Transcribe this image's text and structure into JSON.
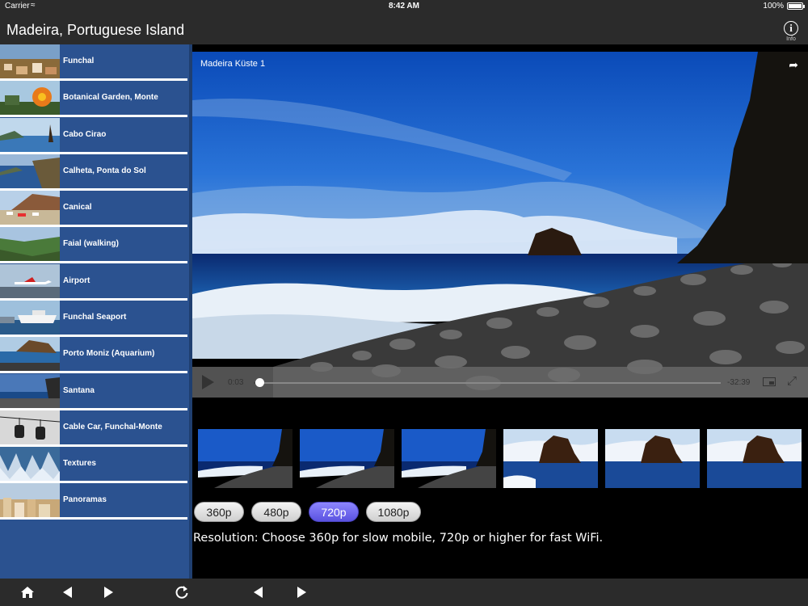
{
  "status_bar": {
    "carrier": "Carrier",
    "time": "8:42 AM",
    "battery": "100%"
  },
  "nav": {
    "title": "Madeira, Portuguese Island",
    "info_label": "Info"
  },
  "sidebar": {
    "items": [
      {
        "label": "Funchal"
      },
      {
        "label": "Botanical Garden, Monte"
      },
      {
        "label": "Cabo Cirao"
      },
      {
        "label": "Calheta, Ponta do Sol"
      },
      {
        "label": "Canical"
      },
      {
        "label": "Faial (walking)"
      },
      {
        "label": "Airport"
      },
      {
        "label": "Funchal Seaport"
      },
      {
        "label": "Porto Moniz (Aquarium)"
      },
      {
        "label": "Santana"
      },
      {
        "label": "Cable Car, Funchal-Monte"
      },
      {
        "label": "Textures"
      },
      {
        "label": "Panoramas"
      }
    ]
  },
  "video": {
    "title": "Madeira Küste 1",
    "elapsed": "0:03",
    "remaining": "-32:39",
    "progress": 0.005
  },
  "resolutions": {
    "options": [
      {
        "label": "360p"
      },
      {
        "label": "480p"
      },
      {
        "label": "720p"
      },
      {
        "label": "1080p"
      }
    ],
    "selected": "720p",
    "note": "Resolution: Choose 360p for slow mobile, 720p or higher for fast WiFi."
  },
  "colors": {
    "sidebar": "#2b5290",
    "bars": "#2b2b2b",
    "selected_button": "#6d66f0"
  }
}
